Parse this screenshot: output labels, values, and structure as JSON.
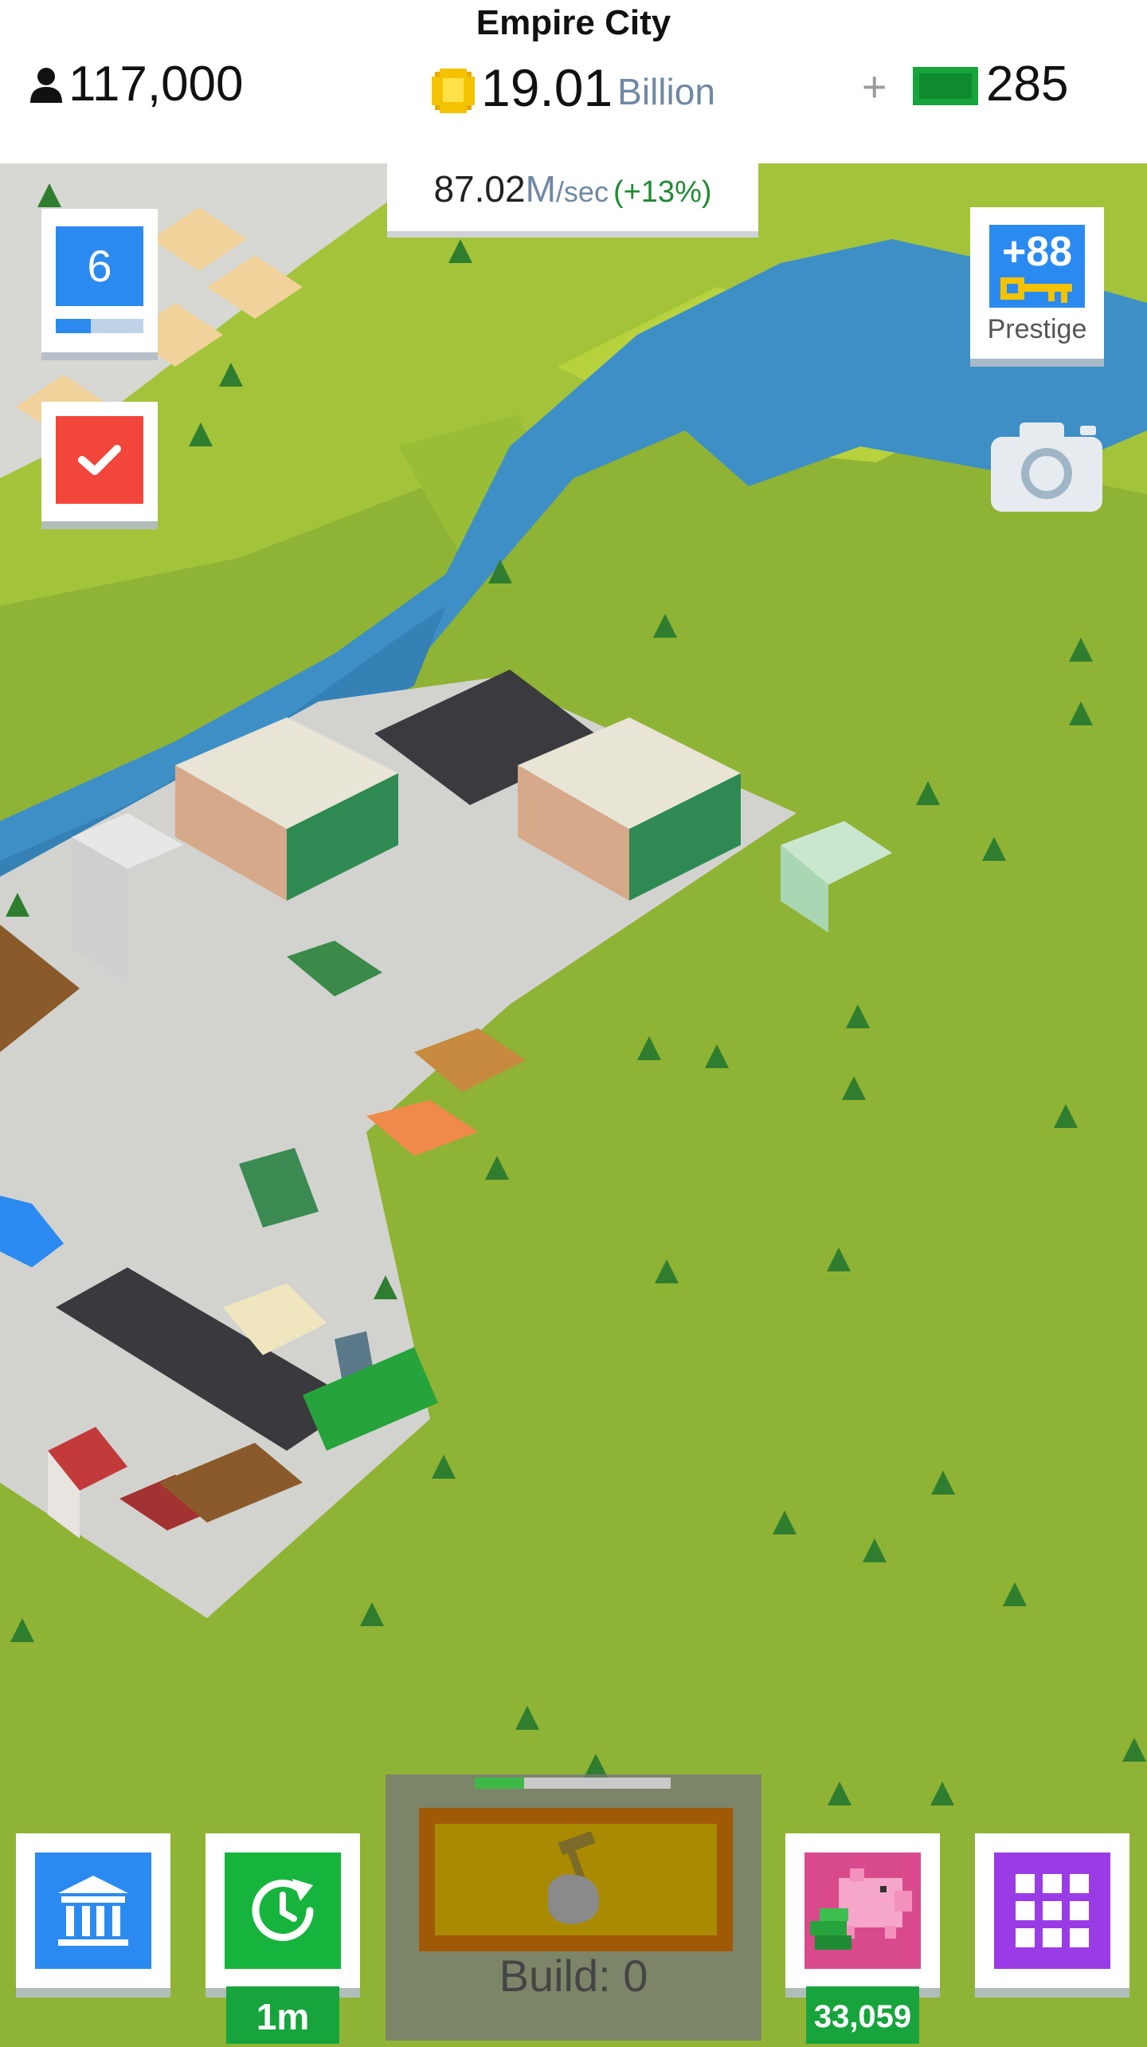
{
  "header": {
    "city_name": "Empire City",
    "population": "117,000",
    "money": "19.01",
    "money_unit": "Billion",
    "plus": "+",
    "cash": "285",
    "income": {
      "value": "87.02",
      "unit": "M",
      "per": "/sec",
      "bonus": "(+13%)"
    }
  },
  "left_panel": {
    "level": "6",
    "level_progress": 0.4
  },
  "right_panel": {
    "prestige_bonus": "+88",
    "prestige_label": "Prestige"
  },
  "bottom_bar": {
    "timewarp_badge": "1m",
    "build_label": "Build: 0",
    "build_progress": 0.25,
    "piggy_badge": "33,059"
  },
  "icons": {
    "population": "person-icon",
    "money": "coin-icon",
    "cash": "cash-icon",
    "task": "checkmark-icon",
    "prestige": "key-icon",
    "camera": "camera-icon",
    "bank": "bank-icon",
    "timewarp": "clock-forward-icon",
    "build": "hammer-hand-icon",
    "piggy": "piggy-bank-icon",
    "menu": "grid-menu-icon"
  },
  "colors": {
    "grass": "#8fb335",
    "river": "#3e8fc6",
    "level_blue": "#2b8af0",
    "task_red": "#f2453b",
    "timewarp_green": "#16b43c",
    "piggy_pink": "#d94a8c",
    "menu_purple": "#9a3ce6",
    "income_bonus_green": "#1f8a34"
  }
}
